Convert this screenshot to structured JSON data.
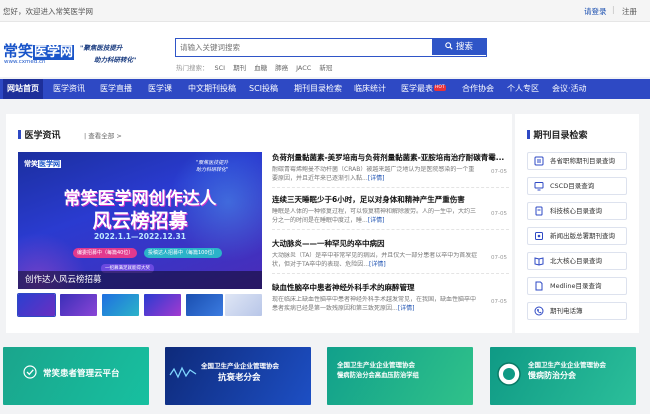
{
  "topbar": {
    "greeting": "您好，欢迎进入常笑医学网",
    "login": "请登录",
    "separator": "|",
    "register": "注册"
  },
  "logo": {
    "brand_a": "常笑",
    "brand_b": "医学网",
    "url": "www.cxmed.cn"
  },
  "slogan": {
    "line1": "\"聚焦医技提升",
    "line2": "助力科研转化\""
  },
  "search": {
    "placeholder": "请输入关键词搜索",
    "button": "搜索",
    "hot_label": "热门搜索：",
    "hot_words": [
      "SCI",
      "期刊",
      "血糖",
      "肺癌",
      "JACC",
      "新冠"
    ]
  },
  "nav": {
    "items": [
      "网站首页",
      "医学资讯",
      "医学直播",
      "医学课",
      "中文期刊投稿",
      "SCI投稿",
      "期刊目录检索",
      "临床统计",
      "医学最表",
      "合作协会",
      "个人专区",
      "会议·活动"
    ],
    "hot_badge": "HOT"
  },
  "news_section": {
    "title": "医学资讯",
    "more": "| 查看全部 >"
  },
  "banner": {
    "logo_a": "常笑",
    "logo_b": "医学网",
    "slogan1": "\"聚焦医技提升",
    "slogan2": "助力科研转化\"",
    "headline1": "常笑医学网创作达人",
    "headline2": "风云榜招募",
    "dates": "2022.1.1—2022.12.31",
    "pill1": "编委招募中（每篇40位）",
    "pill2": "投稿达人招募中（每篇100位）",
    "pill3": "一招募满足就能得大奖",
    "caption": "创作达人风云榜招募"
  },
  "news": [
    {
      "title": "负荷剂量黏菌素-美罗培南与负荷剂量黏菌素-亚胺培南治疗耐碳青霉...",
      "desc": "耐碳青霉烯鲍曼不动杆菌（CRAB）被越来越广泛地认为是医院感染的一个重要原因，并且近年来已逐渐引入黏...",
      "more": "[详情]",
      "date": "07-05"
    },
    {
      "title": "连续三天睡眠少于6小时，足以对身体和精神产生严重伤害",
      "desc": "睡眠是人体的一种修复过程，可以恢复精神和解除疲劳。人的一生中，大约三分之一的时间是在睡眠中度过，睡...",
      "more": "[详情]",
      "date": "07-05"
    },
    {
      "title": "大动脉炎——一种罕见的卒中病因",
      "desc": "大动脉炎（TA）是卒中非常罕见的病因，并且仅大一部分患者以卒中为首发症状，但对于TA卒中的表现、危险因...",
      "more": "[详情]",
      "date": "07-05"
    },
    {
      "title": "缺血性脑卒中患者神经外科手术的麻醉管理",
      "desc": "现在临床上缺血性脑卒中患者神经外科手术越发常见，在我国，缺血性脑卒中患者疾病已经是第一致残原因和第三致死原因...",
      "more": "[详情]",
      "date": "07-05"
    }
  ],
  "side": {
    "title": "期刊目录检索",
    "items": [
      "各省职称期刊目录查询",
      "CSCD目录查询",
      "科技核心目录查询",
      "新闻出版总署期刊查询",
      "北大核心目录查询",
      "Medline目录查询",
      "期刊电话簿"
    ]
  },
  "bottom_banners": [
    {
      "title": "常笑患者管理云平台",
      "sub": ""
    },
    {
      "title": "全国卫生产业企业管理协会",
      "sub": "抗衰老分会"
    },
    {
      "title": "全国卫生产业企业管理协会",
      "sub": "慢病防治分会高血压防治学组"
    },
    {
      "title": "全国卫生产业企业管理协会",
      "sub": "慢病防治分会"
    }
  ],
  "colors": {
    "nav": "#2e49c4",
    "nav_active": "#1d2f9a",
    "accent": "#1a55c9",
    "hot": "#e8323a",
    "teal": "#1aa58c"
  }
}
